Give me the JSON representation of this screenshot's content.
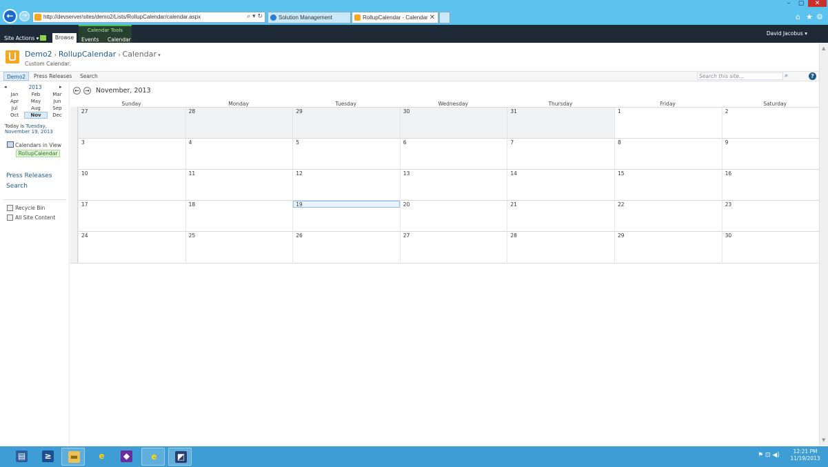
{
  "browser": {
    "url": "http://devserver/sites/demo2/Lists/RollupCalendar/calendar.aspx",
    "url_controls": "⌕ ▾ ↻",
    "tabs": [
      {
        "label": "Solution Management"
      },
      {
        "label": "RollupCalendar - Calendar"
      }
    ],
    "window_controls": {
      "minimize": "–",
      "maximize": "▢",
      "close": "✕"
    },
    "tool_icons": {
      "home": "⌂",
      "favorites": "★",
      "settings": "⚙"
    }
  },
  "ribbon": {
    "site_actions": "Site Actions ▾",
    "browse_tab": "Browse",
    "contextual_group": "Calendar Tools",
    "events_tab": "Events",
    "calendar_tab": "Calendar",
    "user": "David Jacobus ▾"
  },
  "title_area": {
    "crumbs": [
      "Demo2",
      "RollupCalendar",
      "Calendar"
    ],
    "crumb_sep": "›",
    "current_suffix": " ▾",
    "description": "Custom Calendar."
  },
  "top_nav": {
    "items": [
      "Demo2",
      "Press Releases",
      "Search"
    ],
    "search_placeholder": "Search this site...",
    "search_go": "⌕",
    "help": "?"
  },
  "date_picker": {
    "year": "2013",
    "prev": "◂",
    "next": "▸",
    "months": [
      "Jan",
      "Feb",
      "Mar",
      "Apr",
      "May",
      "Jun",
      "Jul",
      "Aug",
      "Sep",
      "Oct",
      "Nov",
      "Dec"
    ],
    "selected_month": "Nov",
    "today_prefix": "Today is ",
    "today_date": "Tuesday, November 19, 2013"
  },
  "left_nav": {
    "calendars_in_view": "Calendars in View",
    "calendar_item": "RollupCalendar",
    "links": [
      "Press Releases",
      "Search"
    ],
    "utilities": [
      "Recycle Bin",
      "All Site Content"
    ]
  },
  "calendar": {
    "title": "November, 2013",
    "prev": "←",
    "next": "→",
    "day_headers": [
      "Sunday",
      "Monday",
      "Tuesday",
      "Wednesday",
      "Thursday",
      "Friday",
      "Saturday"
    ],
    "weeks": [
      [
        "27",
        "28",
        "29",
        "30",
        "31",
        "1",
        "2"
      ],
      [
        "3",
        "4",
        "5",
        "6",
        "7",
        "8",
        "9"
      ],
      [
        "10",
        "11",
        "12",
        "13",
        "14",
        "15",
        "16"
      ],
      [
        "17",
        "18",
        "19",
        "20",
        "21",
        "22",
        "23"
      ],
      [
        "24",
        "25",
        "26",
        "27",
        "28",
        "29",
        "30"
      ]
    ],
    "out_of_month": [
      [
        0,
        0
      ],
      [
        0,
        1
      ],
      [
        0,
        2
      ],
      [
        0,
        3
      ],
      [
        0,
        4
      ]
    ],
    "today": [
      3,
      2
    ]
  },
  "taskbar": {
    "apps": [
      "server-manager",
      "powershell",
      "file-explorer",
      "internet-explorer",
      "visual-studio",
      "internet-explorer-2",
      "remote-desktop"
    ],
    "tray_icons": "⚑ ⊡ ◀)",
    "time": "12:21 PM",
    "date": "11/19/2013"
  }
}
